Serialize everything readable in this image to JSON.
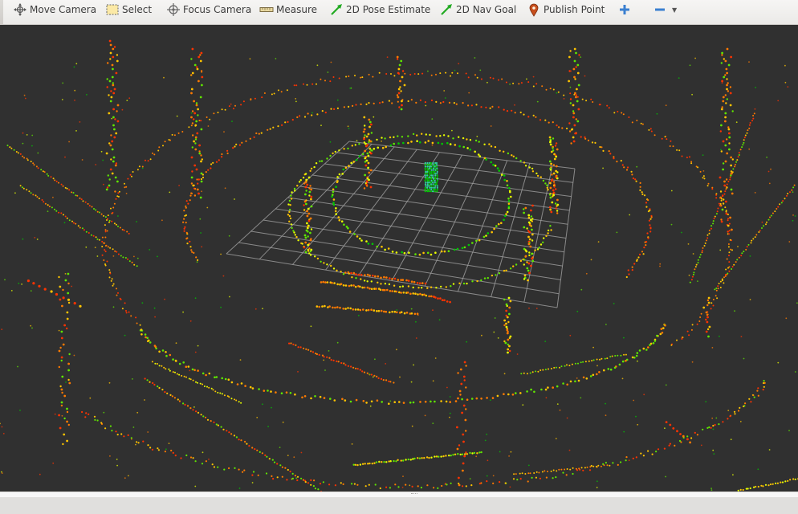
{
  "toolbar": {
    "tools": [
      {
        "id": "move-camera",
        "label": "Move Camera",
        "icon": "move-camera-icon"
      },
      {
        "id": "select",
        "label": "Select",
        "icon": "select-icon"
      },
      {
        "id": "focus-camera",
        "label": "Focus Camera",
        "icon": "focus-camera-icon"
      },
      {
        "id": "measure",
        "label": "Measure",
        "icon": "measure-icon"
      },
      {
        "id": "pose-estimate",
        "label": "2D Pose Estimate",
        "icon": "pose-arrow-icon"
      },
      {
        "id": "nav-goal",
        "label": "2D Nav Goal",
        "icon": "nav-arrow-icon"
      },
      {
        "id": "publish-point",
        "label": "Publish Point",
        "icon": "map-pin-icon"
      }
    ],
    "add_tool_icon": "plus-icon",
    "remove_tool_icon": "minus-icon"
  },
  "viewport": {
    "background": "#303030",
    "grid_color": "#a0a0a0",
    "point_colors": [
      "#ff3300",
      "#ff7a00",
      "#ffc400",
      "#e8ff00",
      "#5fe600",
      "#00c800"
    ],
    "robot_color": "#30d0a0"
  }
}
